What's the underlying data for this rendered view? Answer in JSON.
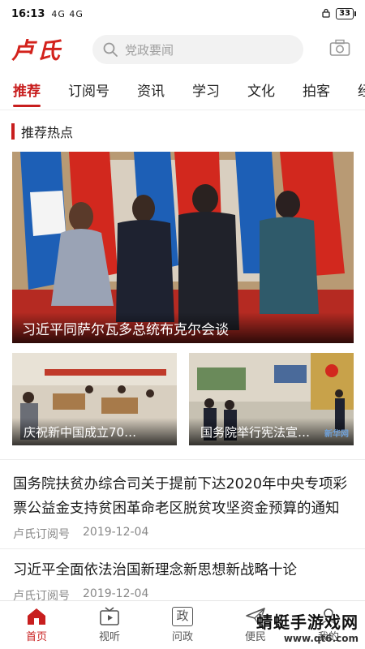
{
  "status_bar": {
    "time": "16:13",
    "network": "4G 4G",
    "battery": "33"
  },
  "header": {
    "logo": "卢氏",
    "search_placeholder": "党政要闻"
  },
  "tabs": [
    {
      "label": "推荐",
      "active": true
    },
    {
      "label": "订阅号",
      "active": false
    },
    {
      "label": "资讯",
      "active": false
    },
    {
      "label": "学习",
      "active": false
    },
    {
      "label": "文化",
      "active": false
    },
    {
      "label": "拍客",
      "active": false
    },
    {
      "label": "经济",
      "active": false
    }
  ],
  "section": {
    "title": "推荐热点"
  },
  "hero": {
    "caption": "习近平同萨尔瓦多总统布克尔会谈"
  },
  "thumbs": [
    {
      "caption": "庆祝新中国成立70…"
    },
    {
      "caption": "国务院举行宪法宣…",
      "badge": "新华网"
    }
  ],
  "news": [
    {
      "title": "国务院扶贫办综合司关于提前下达2020年中央专项彩票公益金支持贫困革命老区脱贫攻坚资金预算的通知",
      "source": "卢氏订阅号",
      "date": "2019-12-04"
    },
    {
      "title": "习近平全面依法治国新理念新思想新战略十论",
      "source": "卢氏订阅号",
      "date": "2019-12-04"
    }
  ],
  "bottom_nav": [
    {
      "label": "首页",
      "icon": "home-icon",
      "active": true
    },
    {
      "label": "视听",
      "icon": "tv-icon",
      "active": false
    },
    {
      "label": "问政",
      "icon": "zheng-icon",
      "glyph": "政",
      "active": false
    },
    {
      "label": "便民",
      "icon": "send-icon",
      "active": false
    },
    {
      "label": "我的",
      "icon": "user-icon",
      "active": false
    }
  ],
  "watermark": {
    "line1": "蜻蜓手游戏网",
    "line2": "www.qt6.com"
  },
  "colors": {
    "brand": "#c81e1e",
    "logo": "#d3221c"
  }
}
